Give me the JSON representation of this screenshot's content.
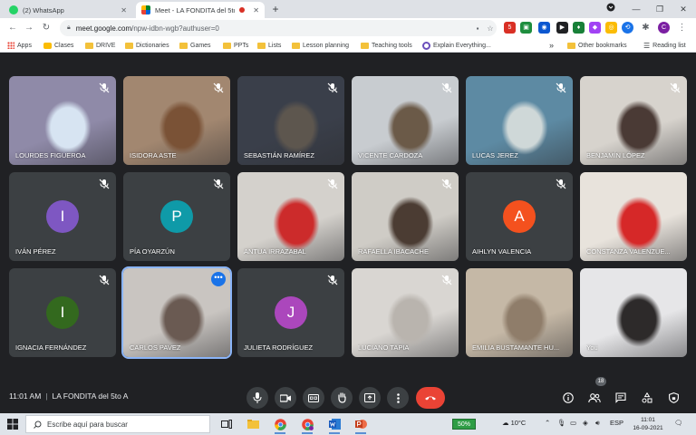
{
  "browser": {
    "tabs": [
      {
        "title": "(2) WhatsApp",
        "active": false
      },
      {
        "title": "Meet - LA FONDITA del 5to",
        "active": true
      }
    ],
    "url_host": "meet.google.com",
    "url_path": "/npw-idbn-wgb?authuser=0",
    "profile_initial": "C",
    "extension_badge": "5",
    "bookmarks": [
      {
        "label": "Apps",
        "icon": "apps-grid-icon"
      },
      {
        "label": "Clases",
        "icon": "classroom-icon"
      },
      {
        "label": "DRIVE",
        "icon": "folder-icon"
      },
      {
        "label": "Dictionaries",
        "icon": "folder-icon"
      },
      {
        "label": "Games",
        "icon": "folder-icon"
      },
      {
        "label": "PPTs",
        "icon": "folder-icon"
      },
      {
        "label": "Lists",
        "icon": "folder-icon"
      },
      {
        "label": "Lesson planning",
        "icon": "folder-icon"
      },
      {
        "label": "Teaching tools",
        "icon": "folder-icon"
      },
      {
        "label": "Explain Everything...",
        "icon": "explain-icon"
      }
    ],
    "overflow_label": "»",
    "other_bookmarks": "Other bookmarks",
    "reading_list": "Reading list"
  },
  "meeting": {
    "time": "11:01 AM",
    "title": "LA FONDITA del 5to A",
    "participant_count": "18",
    "participants": [
      {
        "name": "LOURDES FIGUEROA",
        "muted": true,
        "video": true,
        "bg": "#8f8aa8",
        "fg": "#d7e4f2"
      },
      {
        "name": "ISIDORA ASTE",
        "muted": true,
        "video": true,
        "bg": "#a28770",
        "fg": "#7a5236"
      },
      {
        "name": "SEBASTIÁN RAMÍREZ",
        "muted": true,
        "video": true,
        "bg": "#3a3f4a",
        "fg": "#5d564e"
      },
      {
        "name": "VICENTE CARDOZA",
        "muted": true,
        "video": true,
        "bg": "#c8ccd0",
        "fg": "#6b5a48"
      },
      {
        "name": "LUCAS JEREZ",
        "muted": true,
        "video": true,
        "bg": "#5d8aa3",
        "fg": "#cfd8d8"
      },
      {
        "name": "BENJAMÍN LÓPEZ",
        "muted": true,
        "video": true,
        "bg": "#d7d3cd",
        "fg": "#4a3a35"
      },
      {
        "name": "IVÁN PÉREZ",
        "muted": true,
        "video": false,
        "initial": "I",
        "avatar_color": "#7e57c2"
      },
      {
        "name": "PÍA OYARZÚN",
        "muted": true,
        "video": false,
        "initial": "P",
        "avatar_color": "#0f9aa8"
      },
      {
        "name": "ANTUA IRRAZABAL",
        "muted": true,
        "video": true,
        "bg": "#d4d1cc",
        "fg": "#cc2b2b"
      },
      {
        "name": "RAFAELLA IBACACHE",
        "muted": true,
        "video": true,
        "bg": "#cfccc6",
        "fg": "#4b3c33"
      },
      {
        "name": "AIHLYN VALENCIA",
        "muted": true,
        "video": false,
        "initial": "A",
        "avatar_color": "#f4511e"
      },
      {
        "name": "CONSTANZA VALENZUE...",
        "muted": false,
        "video": true,
        "bg": "#e8e3dc",
        "fg": "#d62828"
      },
      {
        "name": "IGNACIA FERNÁNDEZ",
        "muted": true,
        "video": false,
        "initial": "I",
        "avatar_color": "#33691e"
      },
      {
        "name": "CARLOS PAVEZ",
        "muted": false,
        "video": true,
        "active": true,
        "bg": "#c9c5c1",
        "fg": "#6a5a52"
      },
      {
        "name": "JULIETA RODRÍGUEZ",
        "muted": true,
        "video": false,
        "initial": "J",
        "avatar_color": "#ab47bc"
      },
      {
        "name": "LUCIANO TAPIA",
        "muted": true,
        "video": true,
        "bg": "#d9d6d2",
        "fg": "#b9b4ae"
      },
      {
        "name": "EMILIA BUSTAMANTE HU...",
        "muted": false,
        "video": true,
        "bg": "#c5b8a6",
        "fg": "#8f7d6a"
      },
      {
        "name": "You",
        "muted": false,
        "video": true,
        "bg": "#e6e6e8",
        "fg": "#2d2a2a"
      }
    ]
  },
  "taskbar": {
    "search_placeholder": "Escribe aquí para buscar",
    "battery": "50%",
    "temperature": "10°C",
    "language": "ESP",
    "time": "11:01",
    "date": "16-09-2021"
  },
  "colors": {
    "meet_bg": "#202124",
    "tile_bg": "#3c4043",
    "end_call": "#ea4335",
    "active_speaker": "#8ab4f8"
  }
}
